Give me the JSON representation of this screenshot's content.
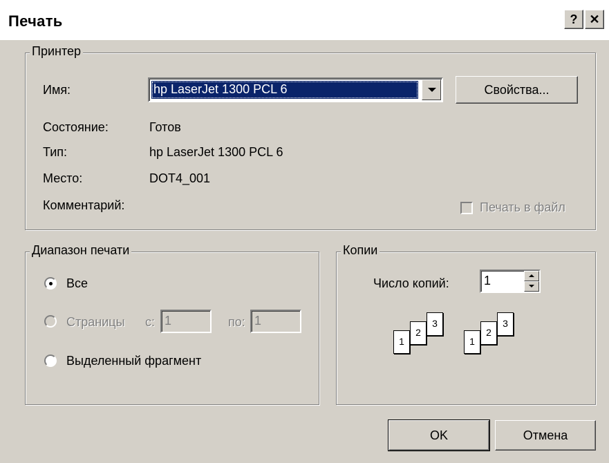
{
  "title": "Печать",
  "title_buttons": {
    "help": "?",
    "close": "✕"
  },
  "printer": {
    "group_label": "Принтер",
    "name_label": "Имя:",
    "name_value": "hp LaserJet 1300 PCL 6",
    "properties_button": "Свойства...",
    "status_label": "Состояние:",
    "status_value": "Готов",
    "type_label": "Тип:",
    "type_value": "hp LaserJet 1300 PCL 6",
    "location_label": "Место:",
    "location_value": "DOT4_001",
    "comment_label": "Комментарий:",
    "print_to_file_label": "Печать в файл",
    "print_to_file_checked": false
  },
  "range": {
    "group_label": "Диапазон печати",
    "all_label": "Все",
    "pages_label": "Страницы",
    "from_label": "с:",
    "from_value": "1",
    "to_label": "по:",
    "to_value": "1",
    "selection_label": "Выделенный фрагмент",
    "selected": "all"
  },
  "copies": {
    "group_label": "Копии",
    "count_label": "Число копий:",
    "count_value": "1",
    "collate_pages": [
      "1",
      "2",
      "3"
    ]
  },
  "buttons": {
    "ok": "OK",
    "cancel": "Отмена"
  }
}
